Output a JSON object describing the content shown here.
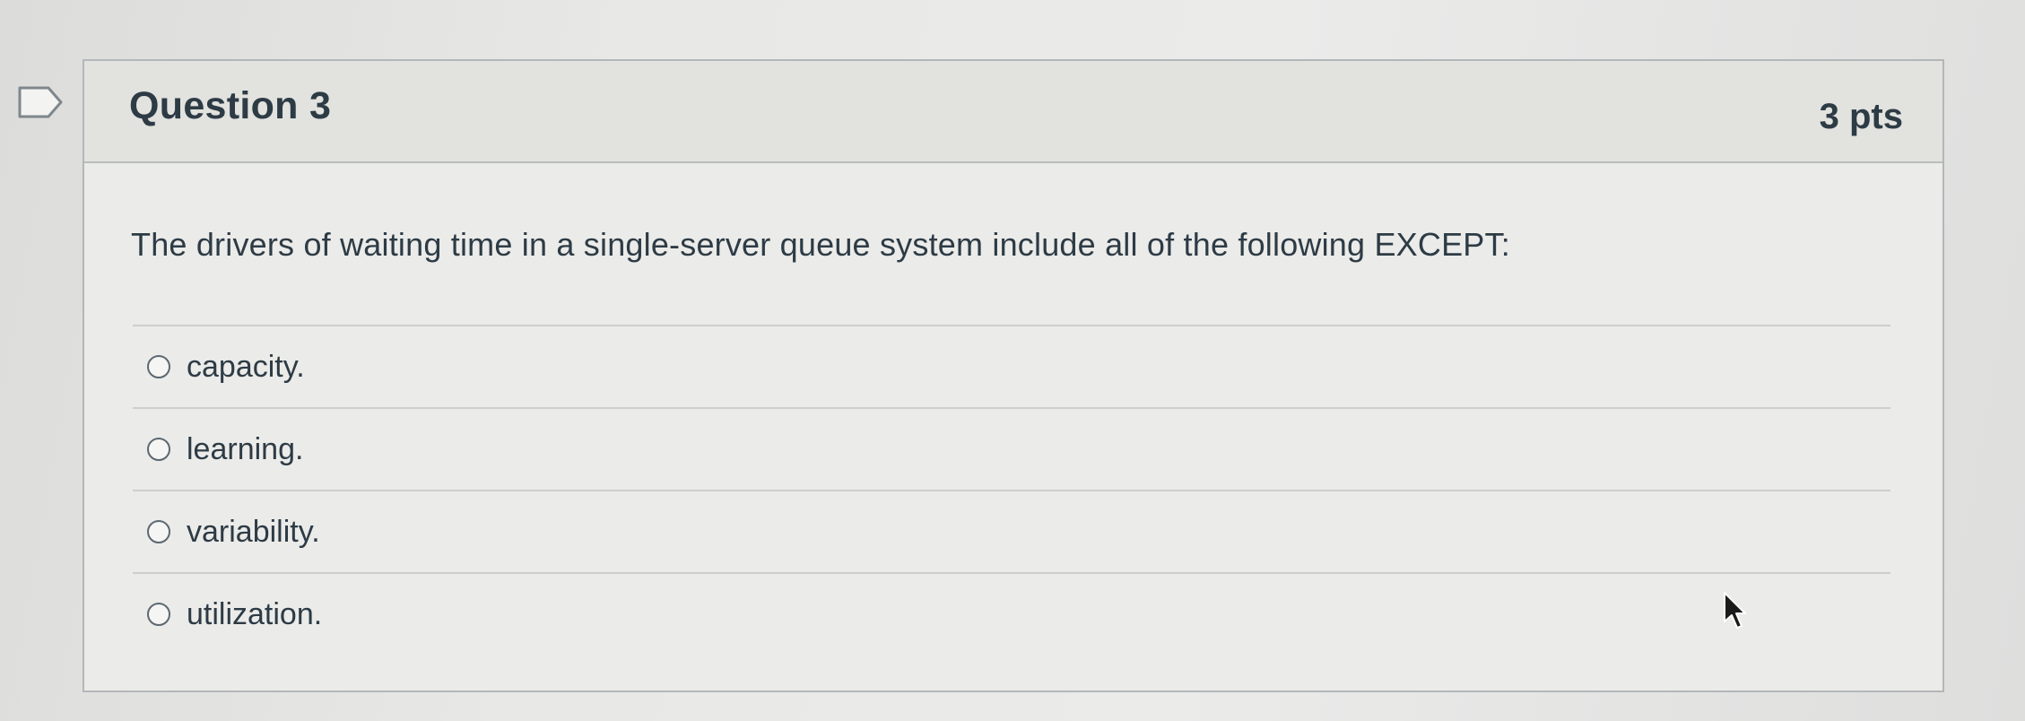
{
  "question": {
    "title": "Question 3",
    "points": "3 pts",
    "text": "The drivers of waiting time in a single-server queue system include all of the following EXCEPT:",
    "answers": [
      {
        "label": "capacity.",
        "selected": false
      },
      {
        "label": "learning.",
        "selected": false
      },
      {
        "label": "variability.",
        "selected": false
      },
      {
        "label": "utilization.",
        "selected": false
      }
    ]
  },
  "icons": {
    "flag": "flag-icon",
    "cursor": "mouse-pointer-icon"
  },
  "colors": {
    "text": "#2d3b45",
    "header_bg": "#e2e2df",
    "card_bg": "#ebebe9",
    "border": "#b3b7b9"
  }
}
